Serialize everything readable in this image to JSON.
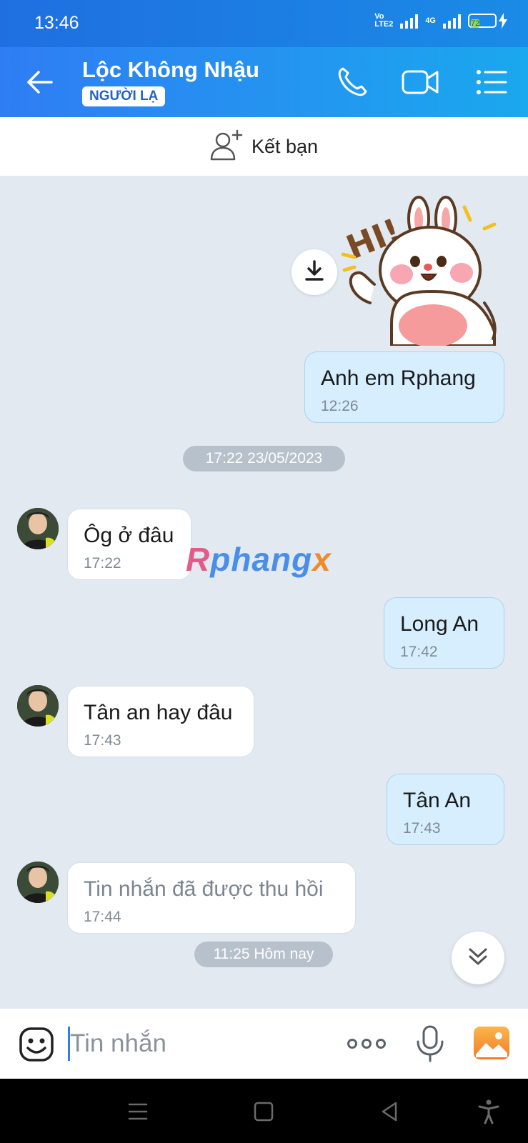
{
  "status_bar": {
    "time": "13:46",
    "volte_label": "Vo\nLTE2",
    "network_label": "4G",
    "battery_level": "72"
  },
  "header": {
    "contact_name": "Lộc Không Nhậu",
    "badge": "NGƯỜI LẠ",
    "icons": [
      "back-arrow-icon",
      "phone-icon",
      "video-call-icon",
      "menu-list-icon"
    ]
  },
  "friend_bar": {
    "label": "Kết bạn",
    "icon": "add-friend-icon"
  },
  "messages": [
    {
      "side": "me",
      "text": "Anh em Rphang",
      "time": "12:26"
    },
    {
      "side": "them",
      "text": "Ôg ở đâu",
      "time": "17:22"
    },
    {
      "side": "me",
      "text": "Long An",
      "time": "17:42"
    },
    {
      "side": "them",
      "text": "Tân an hay đâu",
      "time": "17:43"
    },
    {
      "side": "me",
      "text": "Tân An",
      "time": "17:43"
    },
    {
      "side": "them",
      "text": "Tin nhắn đã được thu hồi",
      "time": "17:44"
    }
  ],
  "date_chips": [
    "17:22 23/05/2023",
    "11:25 Hôm nay"
  ],
  "sticker": {
    "text": "HI!",
    "description_icon": "bunny-sticker"
  },
  "watermark": {
    "part1": "R",
    "part2": "phang",
    "part3": "x"
  },
  "input_bar": {
    "placeholder": "Tin nhắn",
    "icons": [
      "emoji-icon",
      "more-icon",
      "mic-icon",
      "image-icon"
    ]
  },
  "nav_bar": {
    "icons": [
      "menu-icon",
      "home-icon",
      "back-icon",
      "accessibility-icon"
    ]
  },
  "colors": {
    "header_start": "#2f7df3",
    "header_end": "#1aa8ee",
    "my_bubble": "#d6eefe",
    "their_bubble": "#ffffff",
    "chat_bg": "#e2e9f1"
  }
}
